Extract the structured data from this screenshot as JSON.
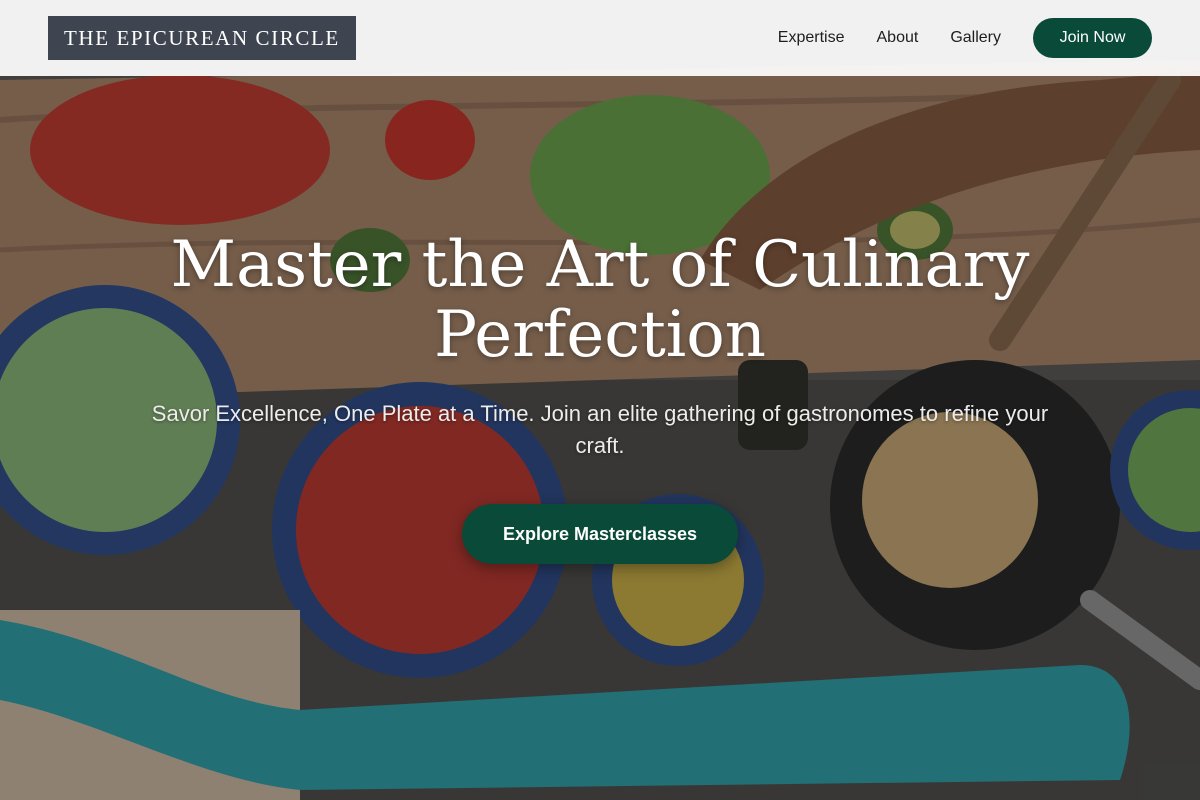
{
  "brand": {
    "name": "THE EPICUREAN CIRCLE"
  },
  "nav": {
    "items": [
      {
        "label": "Expertise"
      },
      {
        "label": "About"
      },
      {
        "label": "Gallery"
      }
    ],
    "cta_label": "Join Now"
  },
  "hero": {
    "title": "Master the Art of Culinary Perfection",
    "subtitle": "Savor Excellence, One Plate at a Time. Join an elite gathering of gastronomes to refine your craft.",
    "cta_label": "Explore Masterclasses"
  },
  "colors": {
    "accent": "#0a4a38",
    "logo_bg": "#3f4550",
    "header_bg": "#ffffff"
  }
}
